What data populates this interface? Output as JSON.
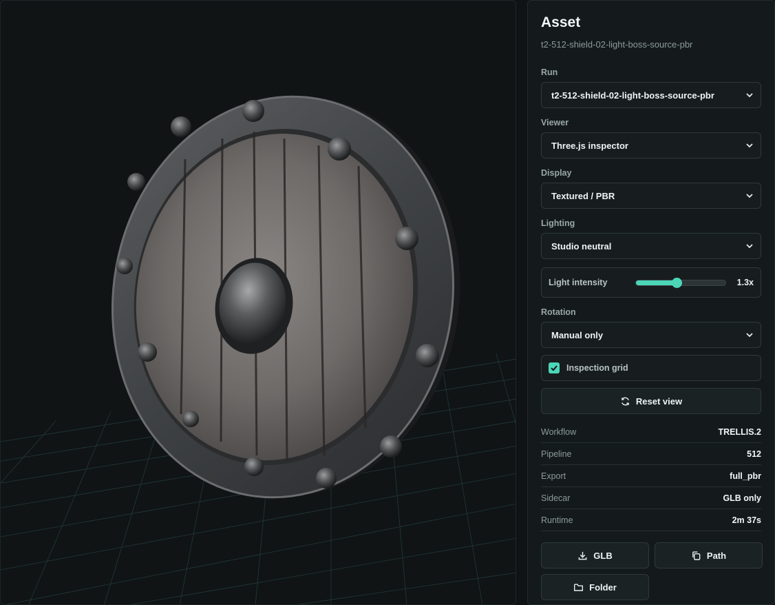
{
  "asset": {
    "title": "Asset",
    "name": "t2-512-shield-02-light-boss-source-pbr"
  },
  "controls": {
    "run": {
      "label": "Run",
      "value": "t2-512-shield-02-light-boss-source-pbr"
    },
    "viewer": {
      "label": "Viewer",
      "value": "Three.js inspector"
    },
    "display": {
      "label": "Display",
      "value": "Textured / PBR"
    },
    "lighting": {
      "label": "Lighting",
      "value": "Studio neutral"
    },
    "light_intensity": {
      "label": "Light intensity",
      "value": "1.3x",
      "fraction": 0.45
    },
    "rotation": {
      "label": "Rotation",
      "value": "Manual only"
    },
    "inspection_grid": {
      "label": "Inspection grid",
      "checked": true
    },
    "reset_view": {
      "label": "Reset view",
      "icon": "refresh-icon"
    }
  },
  "meta": [
    {
      "key": "Workflow",
      "value": "TRELLIS.2"
    },
    {
      "key": "Pipeline",
      "value": "512"
    },
    {
      "key": "Export",
      "value": "full_pbr"
    },
    {
      "key": "Sidecar",
      "value": "GLB only"
    },
    {
      "key": "Runtime",
      "value": "2m 37s"
    }
  ],
  "actions": {
    "glb": {
      "label": "GLB",
      "icon": "download-icon"
    },
    "path": {
      "label": "Path",
      "icon": "copy-icon"
    },
    "folder": {
      "label": "Folder",
      "icon": "folder-icon"
    }
  },
  "colors": {
    "accent": "#4cd6b8",
    "background": "#0f1314",
    "panel": "#141a1b"
  }
}
